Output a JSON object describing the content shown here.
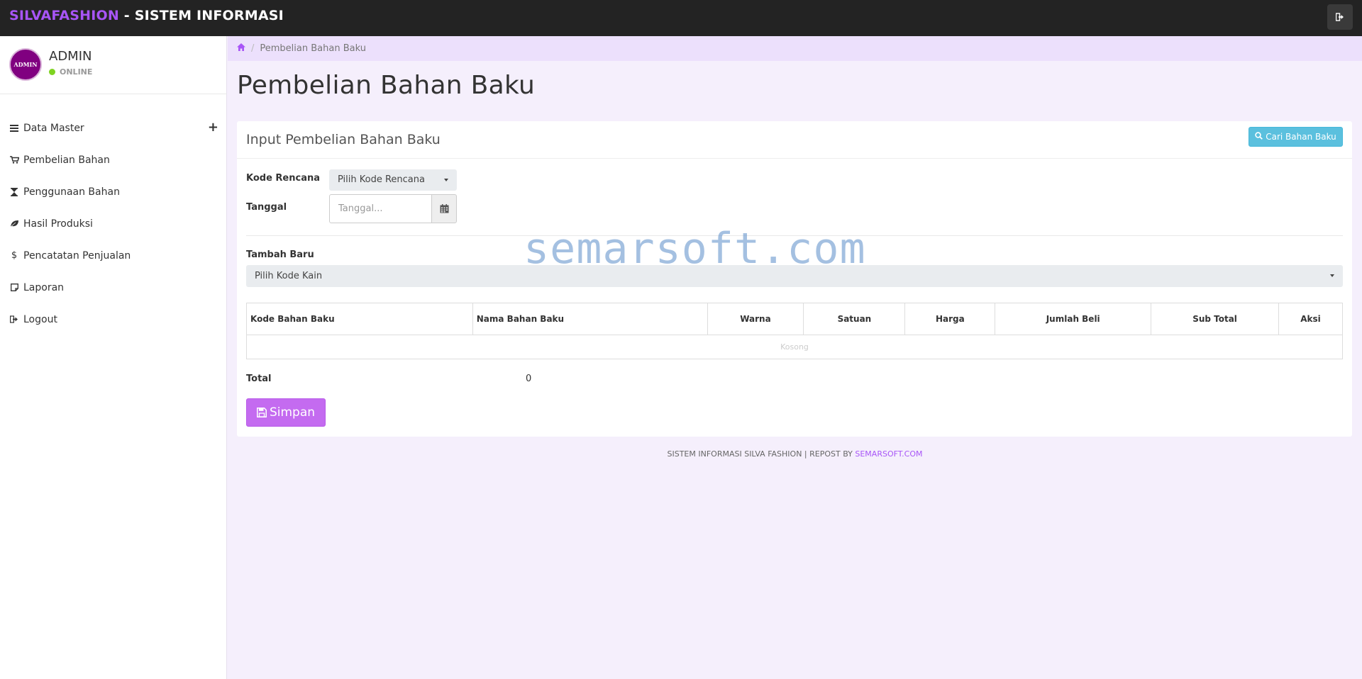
{
  "header": {
    "brand_accent": "SILVAFASHION",
    "brand_rest": " - SISTEM INFORMASI",
    "logout_icon": "sign-out-icon"
  },
  "sidebar": {
    "profile": {
      "avatar_text": "ADMIN",
      "name": "ADMIN",
      "status": "ONLINE"
    },
    "items": [
      {
        "label": "Data Master",
        "icon": "list-icon"
      },
      {
        "label": "Pembelian Bahan",
        "icon": "cart-icon"
      },
      {
        "label": "Penggunaan Bahan",
        "icon": "hourglass-icon"
      },
      {
        "label": "Hasil Produksi",
        "icon": "leaf-icon"
      },
      {
        "label": "Pencatatan Penjualan",
        "icon": "dollar-icon"
      },
      {
        "label": "Laporan",
        "icon": "note-icon"
      },
      {
        "label": "Logout",
        "icon": "sign-out-icon"
      }
    ]
  },
  "breadcrumb": {
    "home_icon": "home-icon",
    "current": "Pembelian Bahan Baku"
  },
  "page": {
    "title": "Pembelian Bahan Baku"
  },
  "panel": {
    "title": "Input Pembelian Bahan Baku",
    "search_button": "Cari Bahan Baku"
  },
  "form": {
    "kode_label": "Kode Rencana",
    "kode_value": "Pilih Kode Rencana",
    "tanggal_label": "Tanggal",
    "tanggal_placeholder": "Tanggal...",
    "tambah_label": "Tambah Baru",
    "kain_value": "Pilih Kode Kain"
  },
  "table": {
    "headers": [
      "Kode Bahan Baku",
      "Nama Bahan Baku",
      "Warna",
      "Satuan",
      "Harga",
      "Jumlah Beli",
      "Sub Total",
      "Aksi"
    ],
    "empty_text": "Kosong"
  },
  "summary": {
    "total_label": "Total",
    "total_value": "0",
    "save_button": "Simpan"
  },
  "watermark": "semarsoft.com",
  "footer": {
    "text": "SISTEM INFORMASI SILVA FASHION | REPOST BY ",
    "link": "SEMARSOFT.COM"
  },
  "colors": {
    "accent": "#a855f7",
    "topbar": "#232323",
    "info": "#5bc0de",
    "save": "#c46bf0",
    "online": "#7ed321"
  }
}
